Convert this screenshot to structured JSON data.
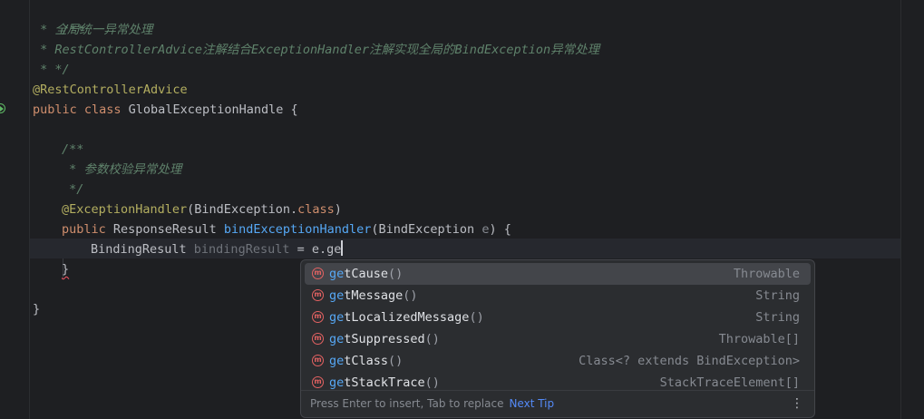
{
  "editor": {
    "lines": [
      {
        "text": "/**"
      },
      {
        "prefix": " * ",
        "text": "全局统一异常处理"
      },
      {
        "prefix": " * ",
        "parts": [
          "RestControllerAdvice",
          "注解结合",
          "ExceptionHandler",
          "注解实现全局的",
          "BindException",
          "异常处理"
        ]
      },
      {
        "text": " * */"
      },
      {
        "text": "@RestControllerAdvice"
      },
      {
        "kw": "public class",
        "text": " GlobalExceptionHandle {"
      },
      {
        "text": "/**"
      },
      {
        "prefix": " * ",
        "text": "参数校验异常处理"
      },
      {
        "text": " */"
      },
      {
        "anno": "@ExceptionHandler",
        "open": "(BindException.",
        "kw": "class",
        "close": ")"
      },
      {
        "kw": "public",
        "type": " ResponseResult ",
        "fn": "bindExceptionHandler",
        "args": "(BindException ",
        "param": "e",
        "end": ") {"
      },
      {
        "type": "BindingResult ",
        "var": "bindingResult",
        "assign": " = e.ge"
      },
      {
        "text": "}"
      },
      {
        "text": "}"
      }
    ]
  },
  "completion": {
    "items": [
      {
        "match": "ge",
        "rest": "tCause",
        "parens": "()",
        "type": "Throwable",
        "icon": "method-icon",
        "selected": true
      },
      {
        "match": "ge",
        "rest": "tMessage",
        "parens": "()",
        "type": "String",
        "icon": "method-icon",
        "selected": false
      },
      {
        "match": "ge",
        "rest": "tLocalizedMessage",
        "parens": "()",
        "type": "String",
        "icon": "method-icon",
        "selected": false
      },
      {
        "match": "ge",
        "rest": "tSuppressed",
        "parens": "()",
        "type": "Throwable[]",
        "icon": "method-icon",
        "selected": false
      },
      {
        "match": "ge",
        "rest": "tClass",
        "parens": "()",
        "type": "Class<? extends BindException>",
        "icon": "method-icon",
        "selected": false
      },
      {
        "match": "ge",
        "rest": "tStackTrace",
        "parens": "()",
        "type": "StackTraceElement[]",
        "icon": "method-icon",
        "selected": false
      }
    ],
    "icon_letter": "m",
    "footer": {
      "hint": "Press Enter to insert, Tab to replace",
      "next_tip": "Next Tip",
      "more": "⋮"
    }
  }
}
